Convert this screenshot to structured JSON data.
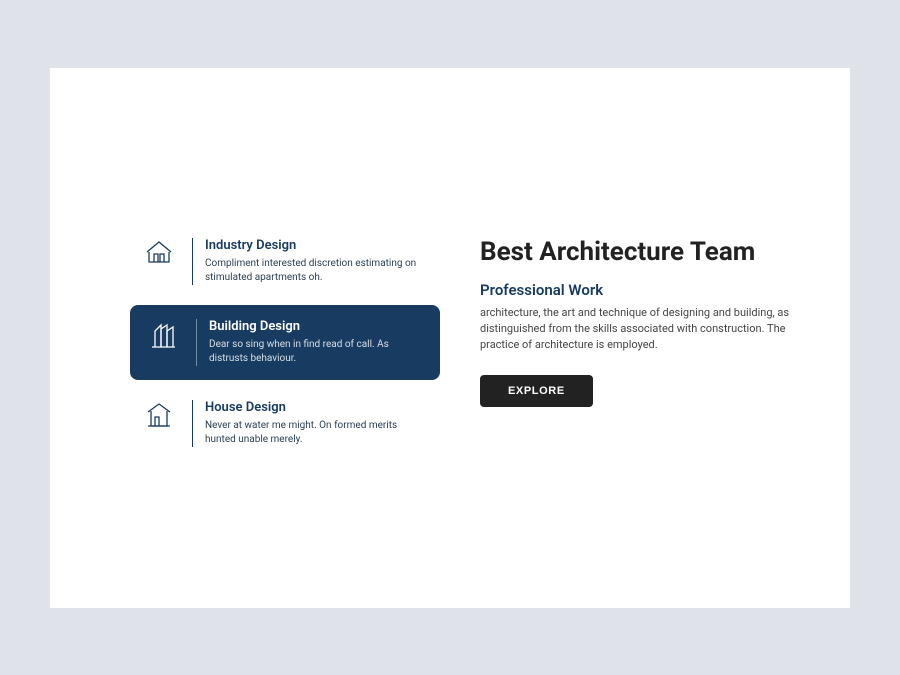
{
  "items": [
    {
      "title": "Industry Design",
      "desc": "Compliment interested discretion estimating on stimulated apartments oh."
    },
    {
      "title": "Building Design",
      "desc": "Dear so sing when in find read of call. As distrusts behaviour."
    },
    {
      "title": "House Design",
      "desc": " Never at water me might. On formed merits hunted unable merely."
    }
  ],
  "content": {
    "heading": "Best Architecture Team",
    "subheading": "Professional Work",
    "body": "architecture, the art and technique of designing and building, as distinguished from the skills associated with construction. The practice of architecture is employed.",
    "cta": "EXPLORE"
  },
  "colors": {
    "primary": "#183c61",
    "button": "#222222"
  }
}
